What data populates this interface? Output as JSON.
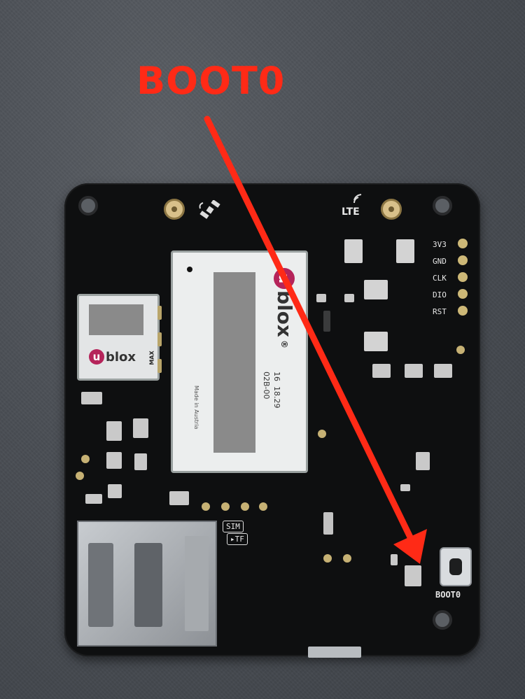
{
  "callout": {
    "label": "BOOT0",
    "color": "#ff2a16"
  },
  "board": {
    "antenna_labels": {
      "lte": "LTE"
    },
    "header_pins": [
      "3V3",
      "GND",
      "CLK",
      "DIO",
      "RST"
    ],
    "socket_labels": {
      "sim": "SIM",
      "tf": "TF"
    },
    "button_label": "BOOT0"
  },
  "gnss_module": {
    "brand": "blox",
    "brand_prefix": "u",
    "tag": "MAX"
  },
  "cellular_module": {
    "brand": "blox",
    "brand_prefix": "u",
    "registered_mark": "®",
    "lines": [
      "16  18.29",
      "02B-00"
    ],
    "made_in": "Made in Austria"
  },
  "colors": {
    "pcb": "#0e0f10",
    "background": "#4a4e54",
    "ublox": "#b5245a",
    "gold": "#c6b174"
  }
}
